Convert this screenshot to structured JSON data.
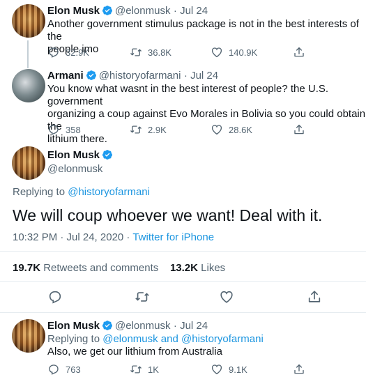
{
  "tweet1": {
    "name": "Elon Musk",
    "handle": "@elonmusk",
    "date": "· Jul 24",
    "text_line1": "Another government stimulus package is not in the best interests of the",
    "text_line2": "people imo",
    "replies": "32.9K",
    "retweets": "36.8K",
    "likes": "140.9K"
  },
  "tweet2": {
    "name": "Armani",
    "handle": "@historyofarmani",
    "date": "· Jul 24",
    "text_line1": "You know what wasnt in the best interest of people? the U.S. government",
    "text_line2": "organizing a coup against Evo Morales in Bolivia so you could obtain the",
    "text_line3": "lithium there.",
    "replies": "358",
    "retweets": "2.9K",
    "likes": "28.6K"
  },
  "main": {
    "name": "Elon Musk",
    "handle": "@elonmusk",
    "replying_prefix": "Replying to",
    "replying_to": "@historyofarmani",
    "text": "We will coup whoever we want! Deal with it.",
    "timestamp": "10:32 PM · Jul 24, 2020 · ",
    "source": "Twitter for iPhone",
    "retweets_count": "19.7K",
    "retweets_label": "Retweets and comments",
    "likes_count": "13.2K",
    "likes_label": "Likes"
  },
  "tweet3": {
    "name": "Elon Musk",
    "handle": "@elonmusk",
    "date": "· Jul 24",
    "replying_prefix": "Replying to",
    "replying_to": "@elonmusk and @historyofarmani",
    "text": "Also, we get our lithium from Australia",
    "replies": "763",
    "retweets": "1K",
    "likes": "9.1K"
  },
  "colors": {
    "link": "#1b95e0",
    "verified": "#1d9bf0",
    "muted": "#536471"
  },
  "icons": [
    "verified-badge-icon",
    "reply-icon",
    "retweet-icon",
    "like-icon",
    "share-icon"
  ]
}
